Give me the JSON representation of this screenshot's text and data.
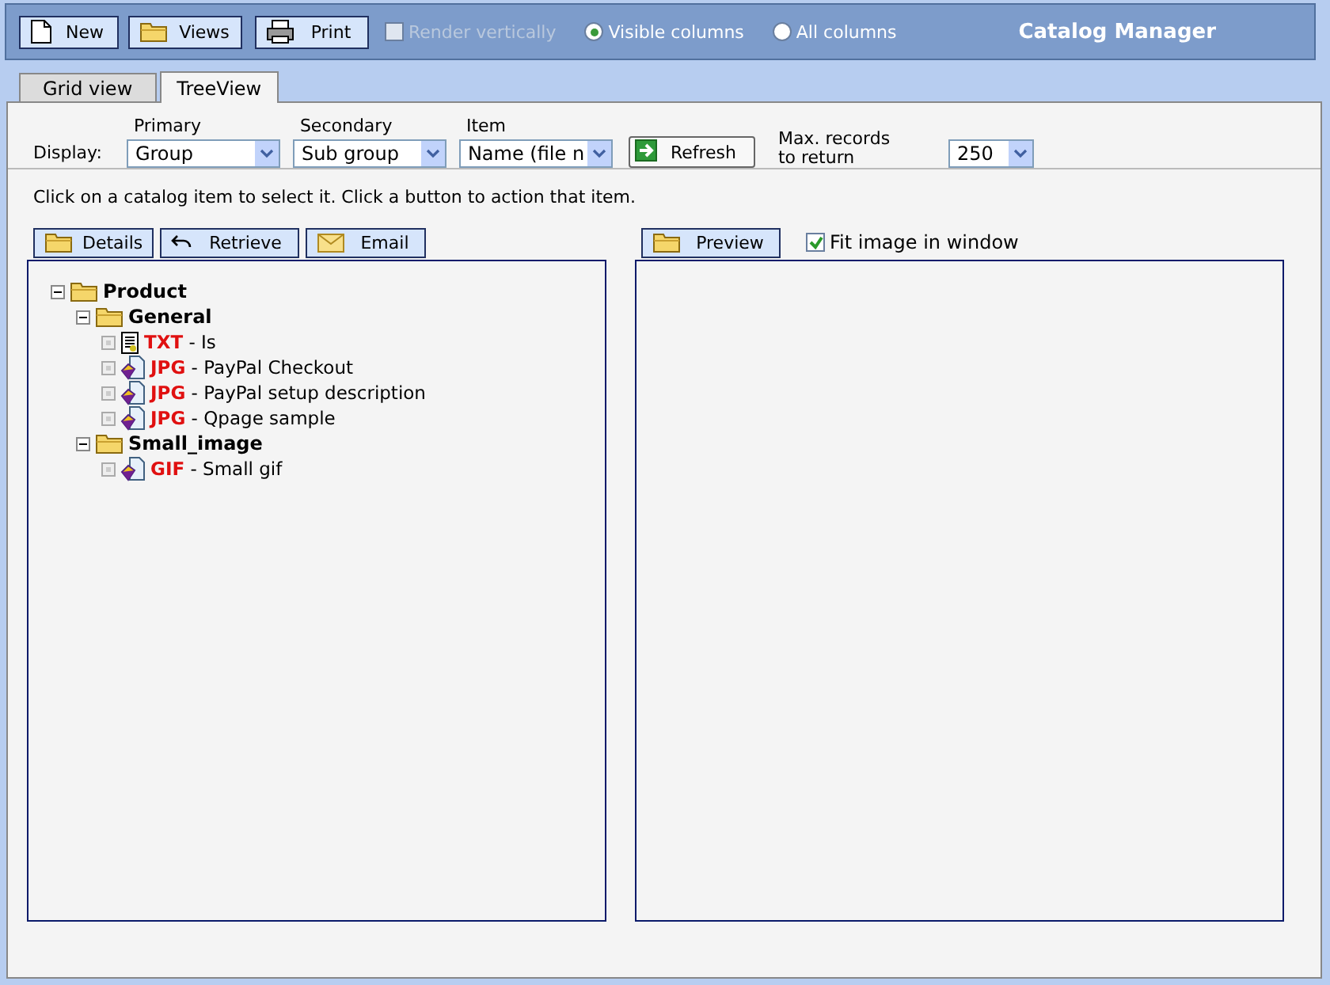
{
  "toolbar": {
    "buttons": [
      {
        "label": "New"
      },
      {
        "label": "Views"
      },
      {
        "label": "Print"
      }
    ],
    "render_vertically": {
      "label": "Render vertically",
      "checked": false,
      "disabled": true
    },
    "columns": [
      {
        "label": "Visible columns",
        "selected": true
      },
      {
        "label": "All columns",
        "selected": false
      }
    ],
    "title": "Catalog Manager"
  },
  "tabs": [
    {
      "label": "Grid view",
      "selected": false
    },
    {
      "label": "TreeView",
      "selected": true
    }
  ],
  "display": {
    "label": "Display:",
    "selects": [
      {
        "caption": "Primary",
        "value": "Group"
      },
      {
        "caption": "Secondary",
        "value": "Sub group"
      },
      {
        "caption": "Item",
        "value": "Name (file n"
      }
    ],
    "refresh": "Refresh",
    "max_label": "Max. records to return",
    "max_value": "250"
  },
  "instructions": "Click on a catalog item to select it. Click a button to action that item.",
  "item_buttons": [
    {
      "label": "Details"
    },
    {
      "label": "Retrieve"
    },
    {
      "label": "Email"
    }
  ],
  "preview": {
    "label": "Preview",
    "fit": {
      "label": "Fit image in window",
      "checked": true
    }
  },
  "tree": [
    {
      "kind": "folder",
      "label": "Product",
      "expanded": true,
      "children": [
        {
          "kind": "folder",
          "label": "General",
          "expanded": true,
          "children": [
            {
              "kind": "text",
              "type": "TXT",
              "label": " - Is"
            },
            {
              "kind": "image",
              "type": "JPG",
              "label": " - PayPal Checkout"
            },
            {
              "kind": "image",
              "type": "JPG",
              "label": " - PayPal setup description"
            },
            {
              "kind": "image",
              "type": "JPG",
              "label": " - Qpage sample"
            }
          ]
        },
        {
          "kind": "folder",
          "label": "Small_image",
          "expanded": true,
          "children": [
            {
              "kind": "image",
              "type": "GIF",
              "label": " - Small gif"
            }
          ]
        }
      ]
    }
  ]
}
